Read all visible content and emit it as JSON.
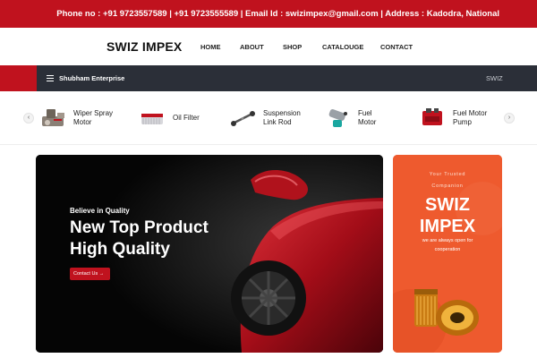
{
  "topbar": {
    "text": "Phone no : +91 9723557589 | +91 9723555589 | Email Id : swizimpex@gmail.com | Address : Kadodra, National"
  },
  "header": {
    "logo": "SWIZ IMPEX",
    "menu": [
      "HOME",
      "ABOUT",
      "SHOP",
      "CATALOUGE",
      "CONTACT"
    ]
  },
  "category_bar": {
    "title": "Shubham Enterprise",
    "right_text": "SWIZ",
    "accent": "#c0121e"
  },
  "products": [
    {
      "line1": "Wiper Spray",
      "line2": "Motor",
      "icon": "wiper-motor-icon"
    },
    {
      "line1": "Oil Filter",
      "line2": "",
      "icon": "oil-filter-icon"
    },
    {
      "line1": "Suspension",
      "line2": "Link Rod",
      "icon": "link-rod-icon"
    },
    {
      "line1": "Fuel",
      "line2": "Motor",
      "icon": "fuel-motor-icon"
    },
    {
      "line1": "Fuel Motor",
      "line2": "Pump",
      "icon": "fuel-pump-icon"
    }
  ],
  "hero": {
    "kicker": "Believe in Quality",
    "heading_line1": "New Top Product",
    "heading_line2": "High Quality",
    "button": "Contact Us"
  },
  "promo": {
    "tag_line1": "Your Trusted",
    "tag_line2": "Companion",
    "brand_line1": "SWIZ",
    "brand_line2": "IMPEX",
    "sub_line1": "we are always open for",
    "sub_line2": "cooperation",
    "bg": "#ee5a2e"
  },
  "colors": {
    "brand_red": "#c0121e",
    "dark_bar": "#2b2f38"
  }
}
